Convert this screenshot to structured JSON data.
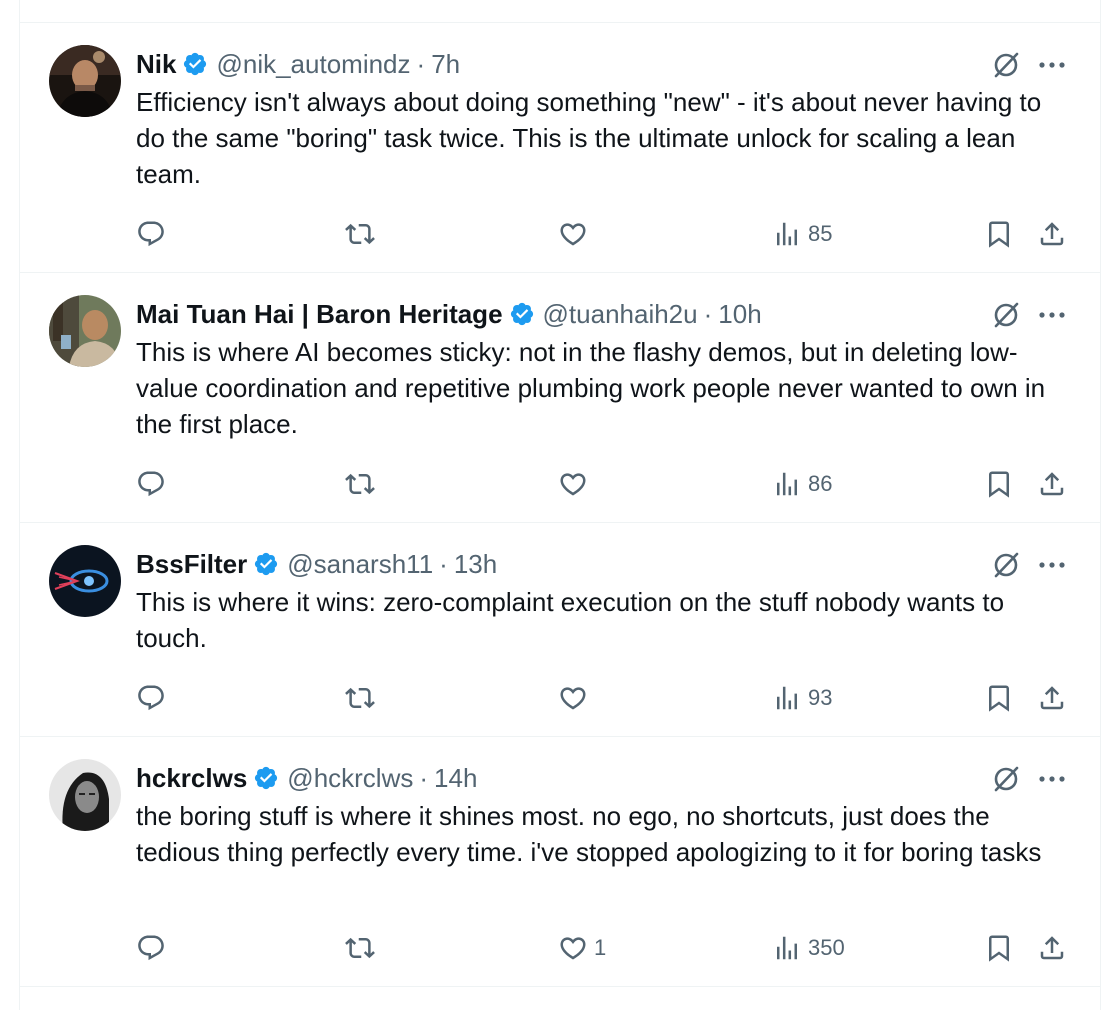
{
  "colors": {
    "verified": "#1d9bf0",
    "secondary_text": "#536471",
    "divider": "#eff3f4"
  },
  "tweets": [
    {
      "name": "Nik",
      "handle": "@nik_automindz",
      "time": "7h",
      "text": "Efficiency isn't always about doing something \"new\" - it's about never having to do the same \"boring\" task twice. This is the ultimate unlock for scaling a lean team.",
      "likes": "",
      "views": "85",
      "avatar_icon": "avatar-photo"
    },
    {
      "name": "Mai Tuan Hai | Baron Heritage",
      "handle": "@tuanhaih2u",
      "time": "10h",
      "text": "This is where AI becomes sticky: not in the flashy demos, but in deleting low-value coordination and repetitive plumbing work people never wanted to own in the first place.",
      "likes": "",
      "views": "86",
      "avatar_icon": "avatar-photo"
    },
    {
      "name": "BssFilter",
      "handle": "@sanarsh11",
      "time": "13h",
      "text": "This is where it wins: zero-complaint execution on the stuff nobody wants to touch.",
      "likes": "",
      "views": "93",
      "avatar_icon": "avatar-logo"
    },
    {
      "name": "hckrclws",
      "handle": "@hckrclws",
      "time": "14h",
      "text": "the boring stuff is where it shines most. no ego, no shortcuts, just does the tedious thing perfectly every time. i've stopped apologizing to it for boring tasks",
      "likes": "1",
      "views": "350",
      "avatar_icon": "avatar-photo"
    }
  ],
  "separator": "·"
}
